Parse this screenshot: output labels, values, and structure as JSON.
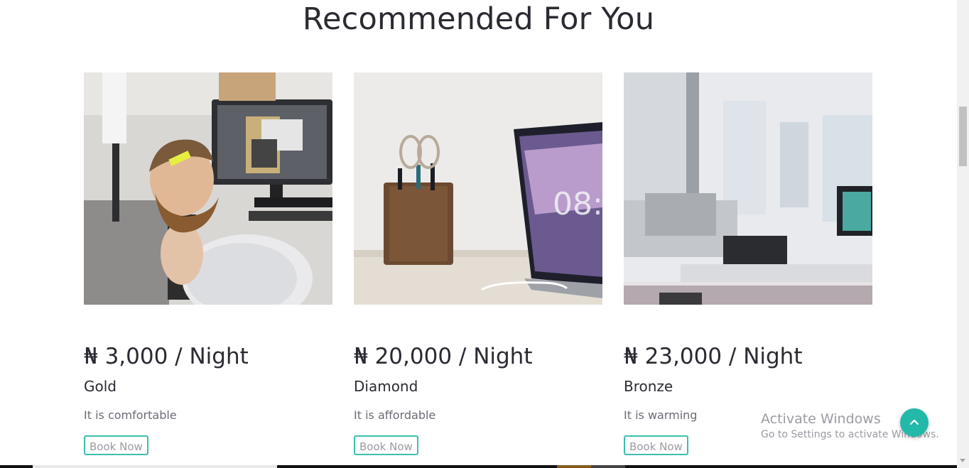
{
  "section": {
    "title": "Recommended For You"
  },
  "cards": [
    {
      "price": "₦ 3,000 / Night",
      "name": "Gold",
      "description": "It is comfortable",
      "button": "Book Now"
    },
    {
      "price": "₦ 20,000 / Night",
      "name": "Diamond",
      "description": "It is affordable",
      "button": "Book Now"
    },
    {
      "price": "₦ 23,000 / Night",
      "name": "Bronze",
      "description": "It is warming",
      "button": "Book Now"
    }
  ],
  "watermark": {
    "title": "Activate Windows",
    "subtitle": "Go to Settings to activate Windows."
  },
  "colors": {
    "accent": "#22b9a9",
    "button_border": "#3cbfae",
    "text": "#2a2a32"
  },
  "icons": {
    "scroll_top": "chevron-up-icon"
  }
}
